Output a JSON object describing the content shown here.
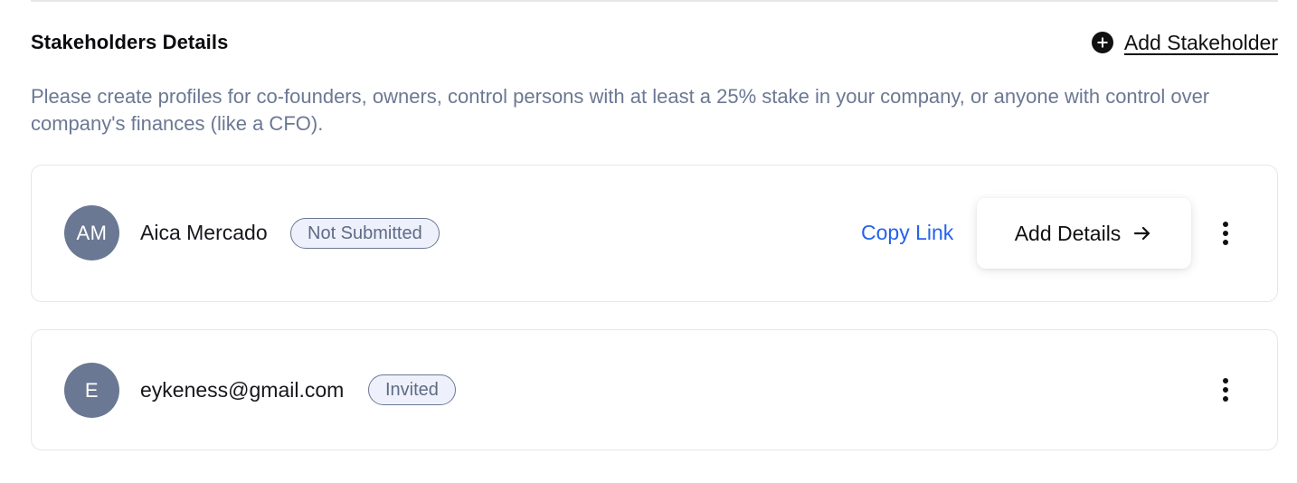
{
  "section": {
    "title": "Stakeholders Details",
    "add_label": "Add Stakeholder",
    "description": "Please create profiles for co-founders, owners, control persons with at least a 25% stake in your company, or anyone with control over company's finances (like a CFO)."
  },
  "stakeholders": [
    {
      "initials": "AM",
      "name": "Aica Mercado",
      "status": "Not Submitted",
      "copy_link_label": "Copy Link",
      "add_details_label": "Add Details"
    },
    {
      "initials": "E",
      "name": "eykeness@gmail.com",
      "status": "Invited"
    }
  ],
  "colors": {
    "avatar_bg": "#6b7893",
    "link": "#2563eb",
    "badge_bg": "#eef1fb",
    "description_text": "#6b7893"
  }
}
